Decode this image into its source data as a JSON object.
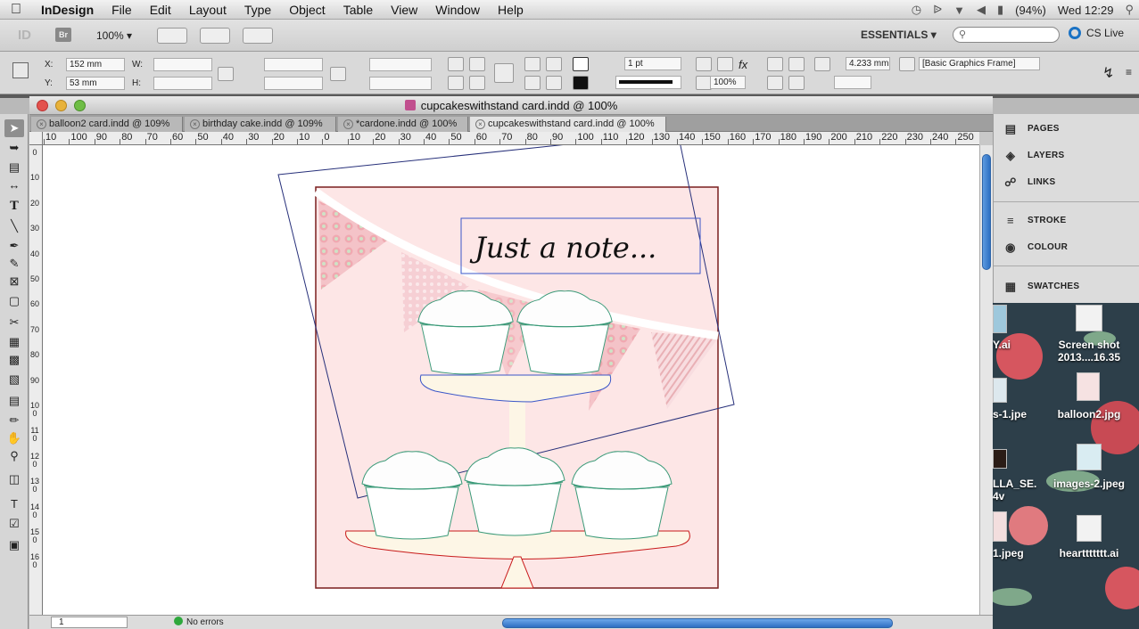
{
  "menubar": {
    "app": "InDesign",
    "items": [
      "File",
      "Edit",
      "Layout",
      "Type",
      "Object",
      "Table",
      "View",
      "Window",
      "Help"
    ],
    "battery": "(94%)",
    "clock": "Wed 12:29"
  },
  "appbar": {
    "logo": "ID",
    "bridge": "Br",
    "zoom": "100%",
    "workspace": "ESSENTIALS",
    "workspace_arrow": "▾",
    "search_placeholder": "",
    "cs_live": "CS Live"
  },
  "control": {
    "x_label": "X:",
    "x_value": "152 mm",
    "y_label": "Y:",
    "y_value": "53 mm",
    "w_label": "W:",
    "h_label": "H:",
    "stroke_weight": "1 pt",
    "opacity": "100%",
    "offset": "4.233 mm",
    "object_style": "[Basic Graphics Frame]"
  },
  "document": {
    "title": "cupcakeswithstand card.indd @ 100%",
    "tabs": [
      {
        "label": "balloon2 card.indd @ 109%",
        "active": false
      },
      {
        "label": "birthday cake.indd @ 109%",
        "active": false
      },
      {
        "label": "*cardone.indd @ 100%",
        "active": false
      },
      {
        "label": "cupcakeswithstand card.indd @ 100%",
        "active": true
      }
    ],
    "ruler_h": [
      "10",
      "100",
      "90",
      "80",
      "70",
      "60",
      "50",
      "40",
      "30",
      "20",
      "10",
      "0",
      "10",
      "20",
      "30",
      "40",
      "50",
      "60",
      "70",
      "80",
      "90",
      "100",
      "110",
      "120",
      "130",
      "140",
      "150",
      "160",
      "170",
      "180",
      "190",
      "200",
      "210",
      "220",
      "230",
      "240",
      "250",
      "2"
    ],
    "ruler_v": [
      "0",
      "10",
      "20",
      "30",
      "40",
      "50",
      "60",
      "70",
      "80",
      "90",
      "100",
      "110",
      "120",
      "130",
      "140",
      "150",
      "160"
    ],
    "note_text": "Just a note...",
    "page_number": "1",
    "preflight": "No errors"
  },
  "panels": {
    "items": [
      "PAGES",
      "LAYERS",
      "LINKS",
      "STROKE",
      "COLOUR",
      "SWATCHES"
    ]
  },
  "desktop": {
    "items": [
      {
        "label": "Y.ai"
      },
      {
        "label": "Screen shot 2013....16.35"
      },
      {
        "label": "s-1.jpe"
      },
      {
        "label": "balloon2.jpg"
      },
      {
        "label": "LLA_SE. 4v"
      },
      {
        "label": "images-2.jpeg"
      },
      {
        "label": "1.jpeg"
      },
      {
        "label": "hearttttttt.ai"
      }
    ]
  },
  "colors": {
    "card_bg": "#fde6e6",
    "cupcake_stroke": "#3a9a78",
    "stand": "#fdf6e6",
    "selection": "#3a56c8"
  }
}
